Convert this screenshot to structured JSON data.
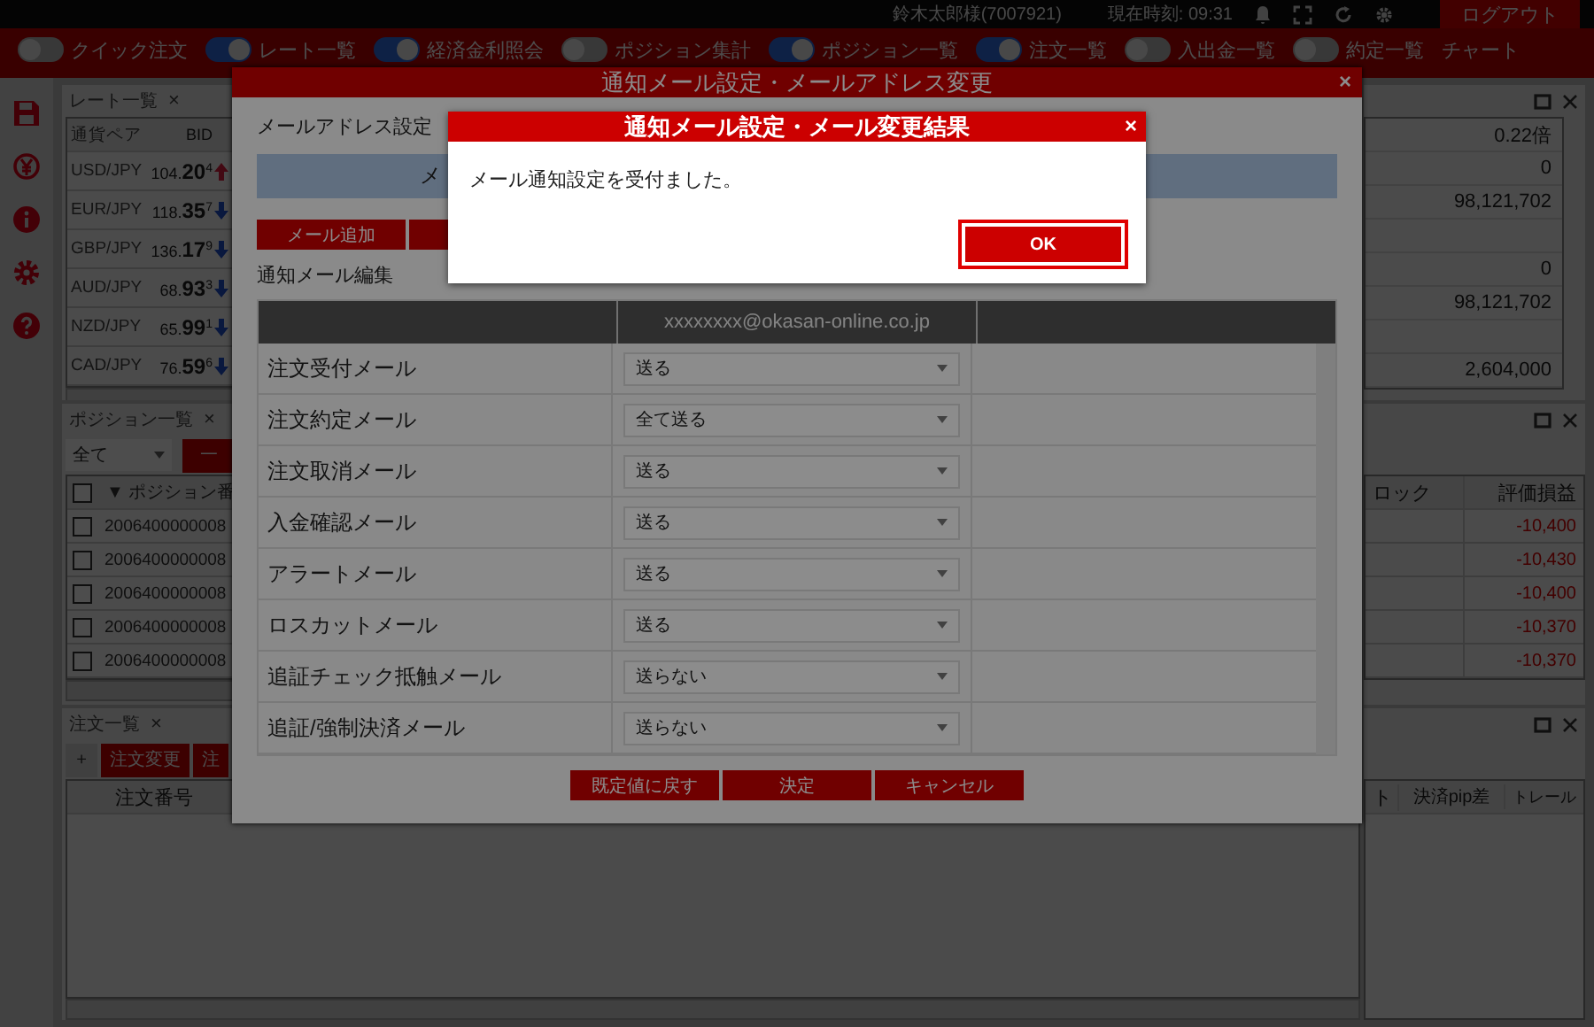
{
  "header": {
    "user": "鈴木太郎様(7007921)",
    "clock": "現在時刻: 09:31",
    "logout": "ログアウト"
  },
  "toolbar": [
    {
      "kind": "toggle",
      "label": "クイック注文",
      "on": false
    },
    {
      "kind": "toggle",
      "label": "レート一覧",
      "on": true
    },
    {
      "kind": "toggle",
      "label": "経済金利照会",
      "on": true
    },
    {
      "kind": "toggle",
      "label": "ポジション集計",
      "on": false
    },
    {
      "kind": "toggle",
      "label": "ポジション一覧",
      "on": true
    },
    {
      "kind": "toggle",
      "label": "注文一覧",
      "on": true
    },
    {
      "kind": "toggle",
      "label": "入出金一覧",
      "on": false
    },
    {
      "kind": "toggle",
      "label": "約定一覧",
      "on": false
    },
    {
      "kind": "text",
      "label": "チャート"
    }
  ],
  "rates": {
    "title": "レート一覧",
    "close": "×",
    "columns": [
      "通貨ペア",
      "BID"
    ],
    "rows": [
      {
        "pair": "USD/JPY",
        "bid": "104.**20**$^{4}$",
        "kind": "rising"
      },
      {
        "pair": "EUR/JPY",
        "bid": "118.**35**$^{7}$",
        "kind": "falling"
      },
      {
        "pair": "GBP/JPY",
        "bid": "136.**17**$^{9}$",
        "kind": "falling"
      },
      {
        "pair": "AUD/JPY",
        "bid": "68.**93**$^{3}$",
        "kind": "falling"
      },
      {
        "pair": "NZD/JPY",
        "bid": "65.**99**$^{1}$",
        "kind": "falling"
      },
      {
        "pair": "CAD/JPY",
        "bid": "76.**59**$^{6}$",
        "kind": "falling"
      }
    ]
  },
  "summary": {
    "groups": [
      [
        "0.22倍",
        "0",
        "98,121,702"
      ],
      [
        "0",
        "98,121,702"
      ],
      [
        "2,604,000"
      ]
    ]
  },
  "positions": {
    "title": "ポジション一覧",
    "close": "×",
    "filter": "全て",
    "bulk_button": "一",
    "select_all_checked": false,
    "columns": [
      "▼ ポジション番"
    ],
    "right_columns": [
      "ロック",
      "評価損益"
    ],
    "rows": [
      {
        "number": "2006400000008",
        "checked": false,
        "pl": "-10,400"
      },
      {
        "number": "2006400000008",
        "checked": false,
        "pl": "-10,430"
      },
      {
        "number": "2006400000008",
        "checked": false,
        "pl": "-10,400"
      },
      {
        "number": "2006400000008",
        "checked": false,
        "pl": "-10,370"
      },
      {
        "number": "2006400000008",
        "checked": false,
        "pl": "-10,370"
      }
    ]
  },
  "orders": {
    "title": "注文一覧",
    "close": "×",
    "buttons": [
      "+",
      "注文変更",
      "注"
    ],
    "columns": [
      "注文番号"
    ],
    "right_columns": [
      "ト",
      "決済pip差",
      "トレール"
    ]
  },
  "settings_dialog": {
    "title": "通知メール設定・メールアドレス変更",
    "close": "×",
    "section_label": "メールアドレス設定",
    "address_bar": "メ",
    "buttons": [
      "メール追加"
    ],
    "edit_label": "通知メール編集",
    "email_column": "xxxxxxxx@okasan-online.co.jp",
    "rows": [
      {
        "name": "注文受付メール",
        "value": "送る"
      },
      {
        "name": "注文約定メール",
        "value": "全て送る"
      },
      {
        "name": "注文取消メール",
        "value": "送る"
      },
      {
        "name": "入金確認メール",
        "value": "送る"
      },
      {
        "name": "アラートメール",
        "value": "送る"
      },
      {
        "name": "ロスカットメール",
        "value": "送る"
      },
      {
        "name": "追証チェック抵触メール",
        "value": "送らない"
      },
      {
        "name": "追証/強制決済メール",
        "value": "送らない"
      }
    ],
    "actions": [
      "既定値に戻す",
      "決定",
      "キャンセル"
    ]
  },
  "result_dialog": {
    "title": "通知メール設定・メール変更結果",
    "close": "×",
    "message": "メール通知設定を受付ました。",
    "ok": "OK",
    "ok_focused": true
  }
}
